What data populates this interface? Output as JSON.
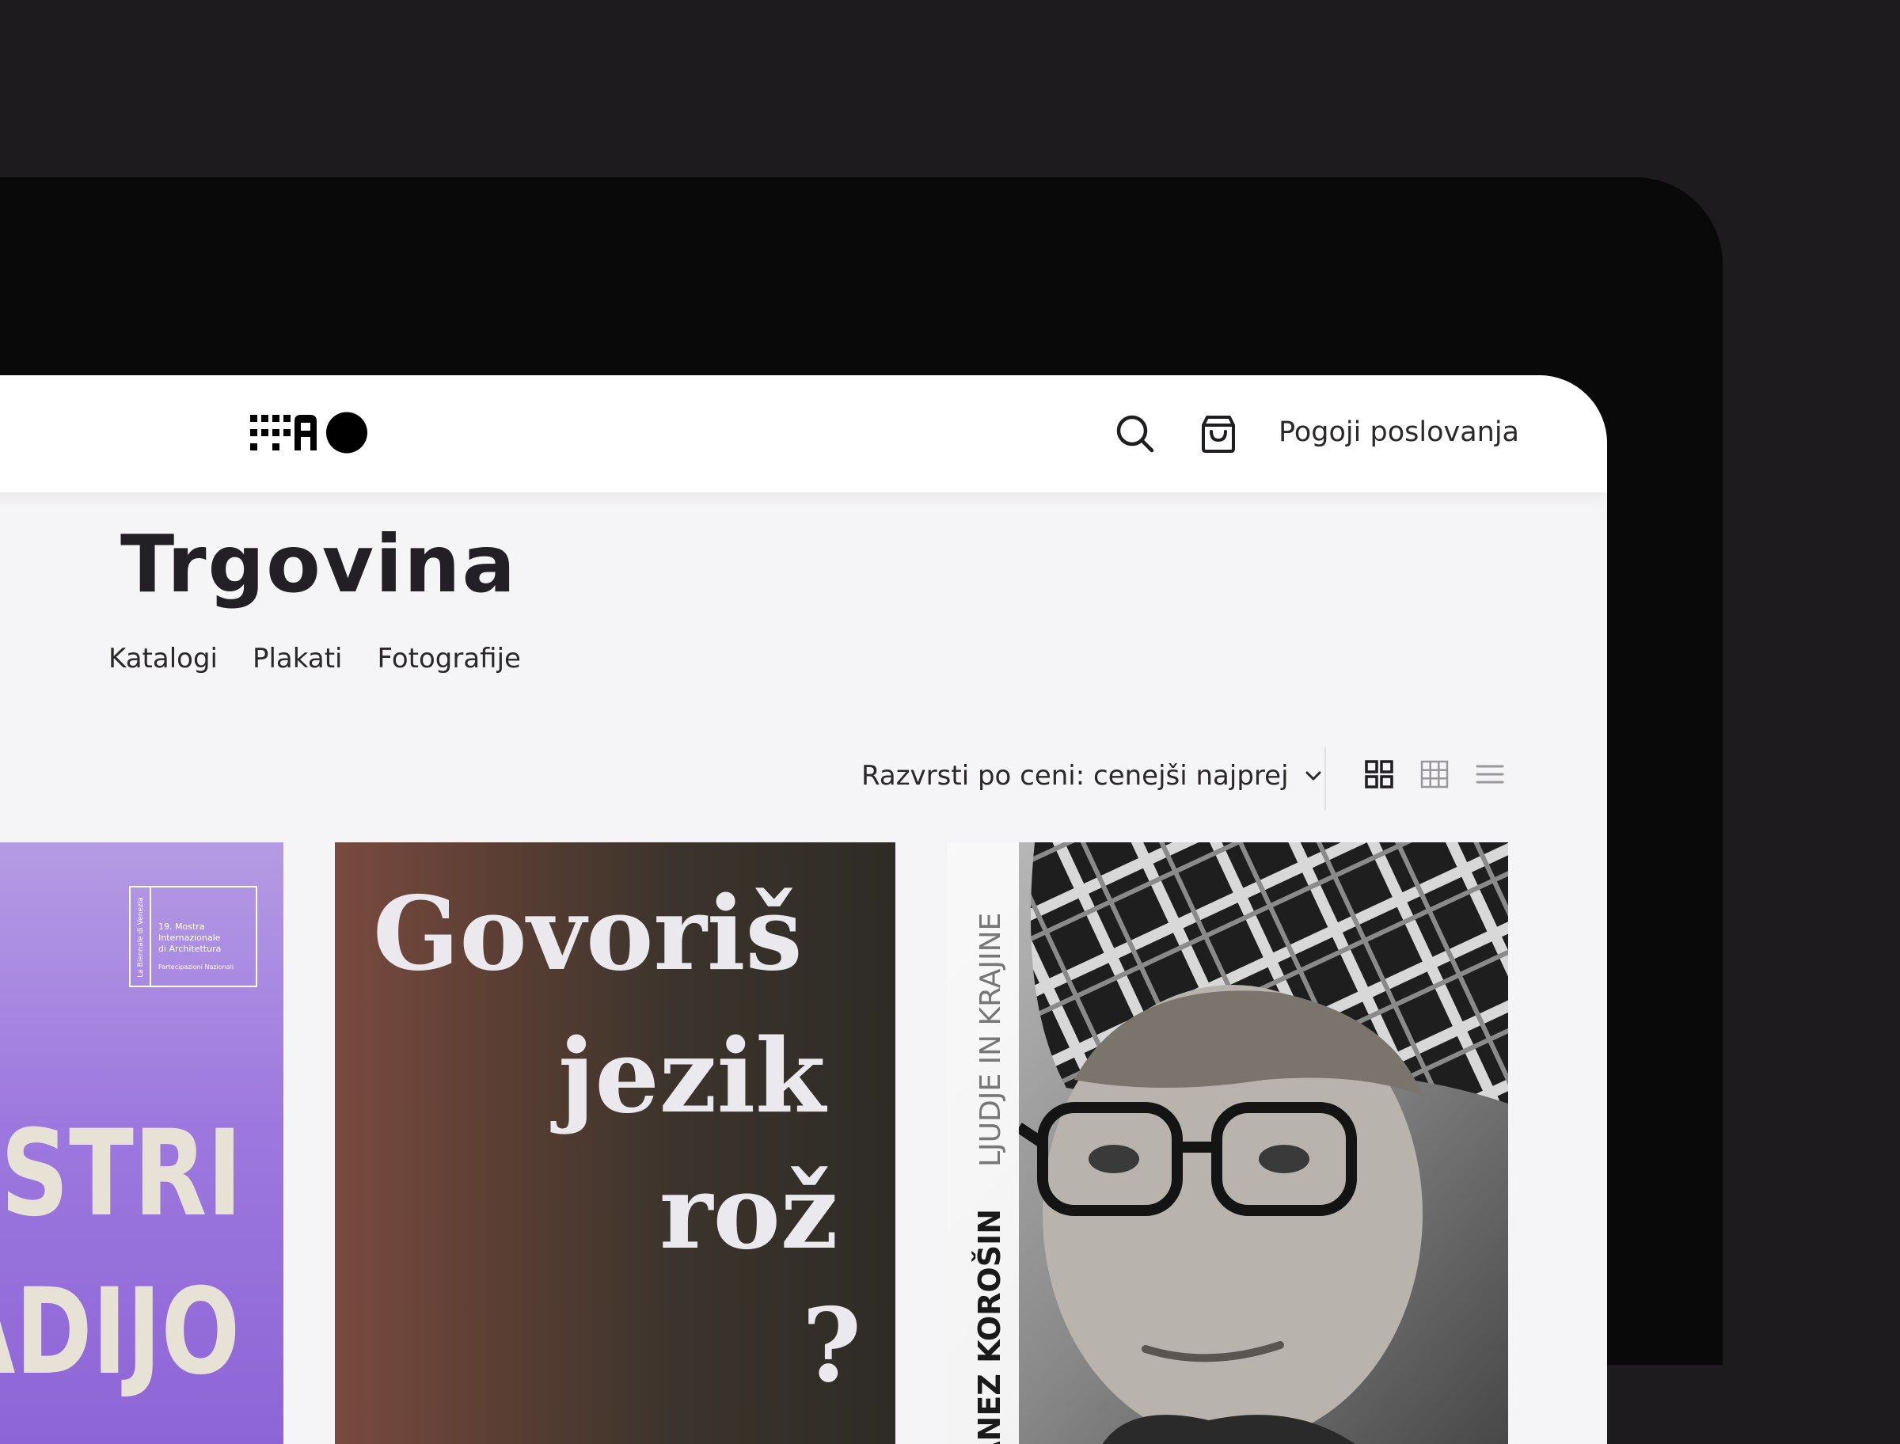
{
  "header": {
    "logo_label": "AO",
    "terms_link": "Pogoji poslovanja",
    "icons": [
      "search-icon",
      "shopping-bag-icon"
    ]
  },
  "page": {
    "title": "Trgovina",
    "categories": [
      "Katalogi",
      "Plakati",
      "Fotografije"
    ]
  },
  "toolbar": {
    "sort_label": "Razvrsti po ceni: cenejši najprej",
    "sort_icon": "chevron-down-icon",
    "view_icons": [
      "grid-2-icon",
      "grid-3-icon",
      "list-icon"
    ]
  },
  "products": [
    {
      "cover_text": [
        "OJSTRI",
        "RADIJO"
      ],
      "badge_lines": [
        "19. Mostra",
        "Internazionale",
        "di Architettura",
        "Partecipazioni Nazionali"
      ],
      "badge_side": "La Biennale di Venezia",
      "colors": {
        "bg": "#9c78de",
        "text": "#e8e2d6"
      }
    },
    {
      "cover_text": [
        "Govoriš",
        "jezik",
        "rož",
        "?"
      ],
      "colors": {
        "bg": "#3c342c",
        "text": "#ece9ee"
      }
    },
    {
      "cover_author": "JANEZ KOROŠIN",
      "cover_title": "LJUDJE IN KRAJINE",
      "colors": {
        "bg": "#8c8c8c",
        "text": "#f2f2f2"
      }
    }
  ]
}
